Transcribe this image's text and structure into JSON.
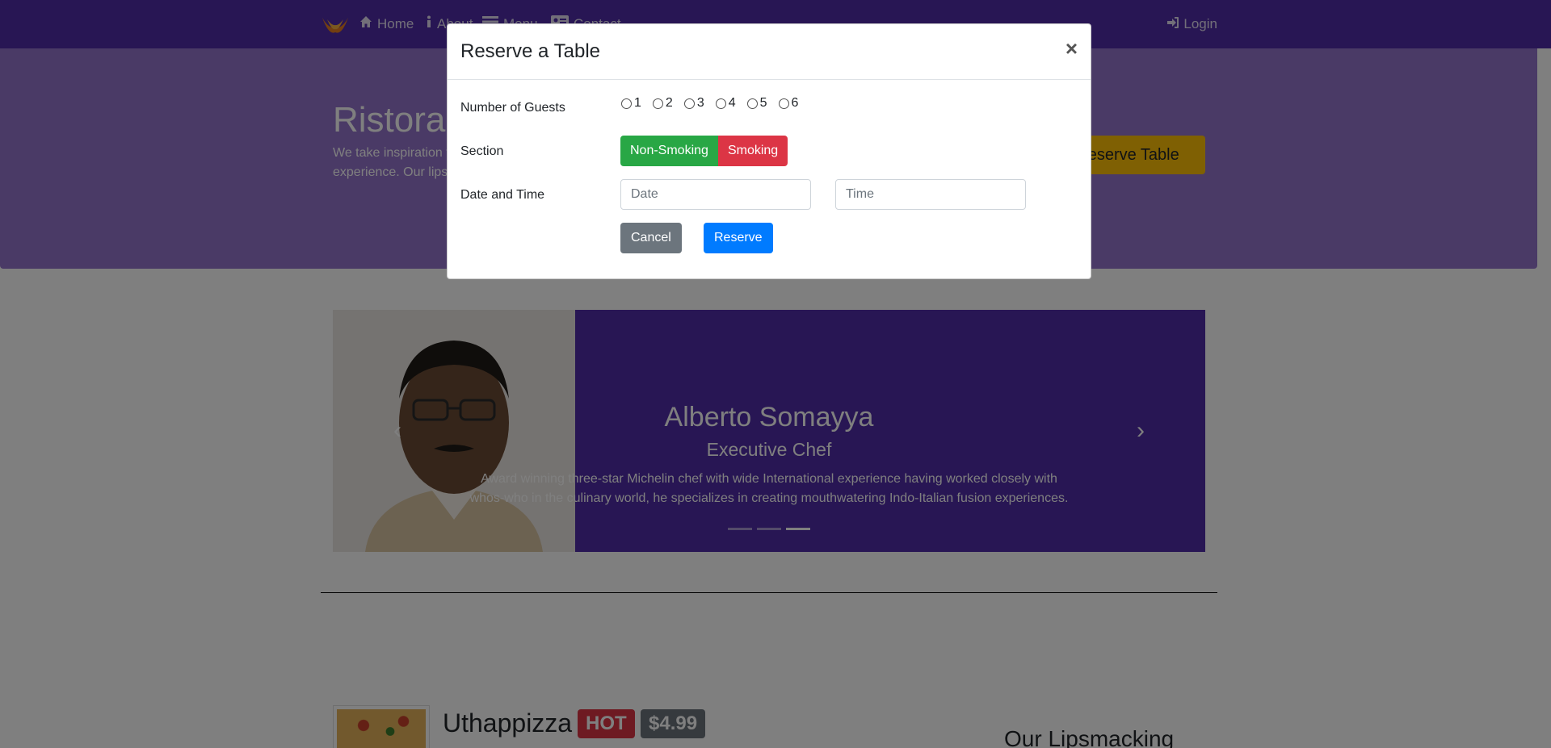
{
  "navbar": {
    "links": {
      "home": "Home",
      "about": "About",
      "menu": "Menu",
      "contact": "Contact",
      "login": "Login"
    }
  },
  "jumbotron": {
    "title": "Ristorante con Fusion",
    "text": "We take inspiration from the World's best cuisines, and create a unique fusion experience. Our lipsmacking creations will tickle your culinary senses!",
    "reserve_button": "Reserve Table"
  },
  "carousel": {
    "name": "Alberto Somayya",
    "role": "Executive Chef",
    "description": "Award winning three-star Michelin chef with wide International experience having worked closely with whos-who in the culinary world, he specializes in creating mouthwatering Indo-Italian fusion experiences.",
    "active_slide": 3,
    "slide_count": 3
  },
  "dish": {
    "name": "Uthappizza",
    "label": "HOT",
    "price": "$4.99"
  },
  "side_heading": "Our Lipsmacking",
  "modal": {
    "title": "Reserve a Table",
    "close": "×",
    "labels": {
      "guests": "Number of Guests",
      "section": "Section",
      "datetime": "Date and Time"
    },
    "guest_options": [
      "1",
      "2",
      "3",
      "4",
      "5",
      "6"
    ],
    "section_options": {
      "non_smoking": "Non-Smoking",
      "smoking": "Smoking"
    },
    "date_placeholder": "Date",
    "time_placeholder": "Time",
    "cancel": "Cancel",
    "reserve": "Reserve"
  },
  "colors": {
    "primary": "#512DA8",
    "light": "#9575CD",
    "warning": "#FFC107",
    "success": "#28a745",
    "danger": "#dc3545",
    "secondary": "#6c757d",
    "blue": "#007bff"
  }
}
